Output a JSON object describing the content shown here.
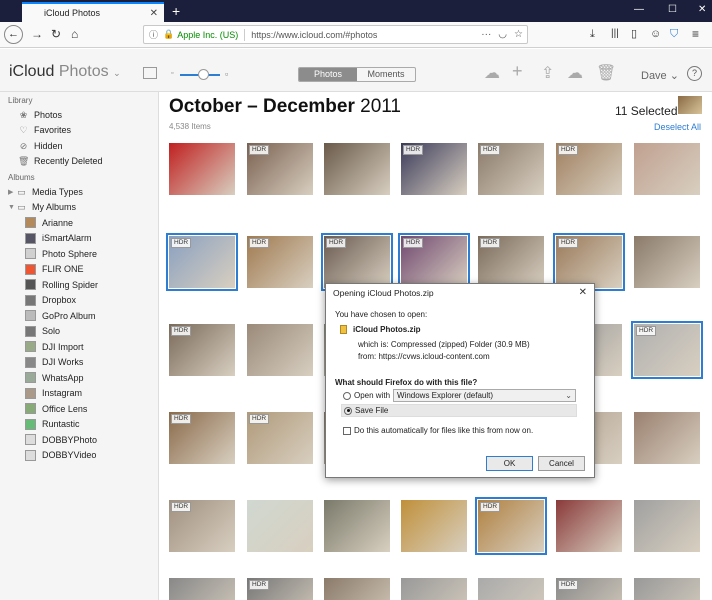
{
  "browser": {
    "tab_title": "iCloud Photos",
    "url_org": "Apple Inc. (US)",
    "url": "https://www.icloud.com/#photos"
  },
  "app": {
    "brand_main": "iCloud",
    "brand_sub": "Photos",
    "tabs": [
      "Photos",
      "Moments"
    ],
    "active_tab": "Photos",
    "user": "Dave",
    "zoom_level": 0.55
  },
  "sidebar": {
    "library_label": "Library",
    "library_items": [
      "Photos",
      "Favorites",
      "Hidden",
      "Recently Deleted"
    ],
    "albums_label": "Albums",
    "media_types": "Media Types",
    "my_albums": "My Albums",
    "album_items": [
      "Arianne",
      "iSmartAlarm",
      "Photo Sphere",
      "FLIR ONE",
      "Rolling Spider",
      "Dropbox",
      "GoPro Album",
      "Solo",
      "DJI Import",
      "DJI Works",
      "WhatsApp",
      "Instagram",
      "Office Lens",
      "Runtastic",
      "DOBBYPhoto",
      "DOBBYVideo"
    ]
  },
  "content": {
    "title_months": "October – December",
    "title_year": "2011",
    "item_count": "4,538 Items",
    "selected_count": "11 Selected",
    "deselect_label": "Deselect All",
    "hdr_label": "HDR"
  },
  "dialog": {
    "title": "Opening iCloud Photos.zip",
    "intro": "You have chosen to open:",
    "filename": "iCloud Photos.zip",
    "which_is": "which is:  Compressed (zipped) Folder (30.9 MB)",
    "from": "from:  https://cvws.icloud-content.com",
    "question": "What should Firefox do with this file?",
    "open_with_label": "Open with",
    "open_with_value": "Windows Explorer (default)",
    "save_label": "Save File",
    "auto_label": "Do this automatically for files like this from now on.",
    "ok": "OK",
    "cancel": "Cancel"
  }
}
